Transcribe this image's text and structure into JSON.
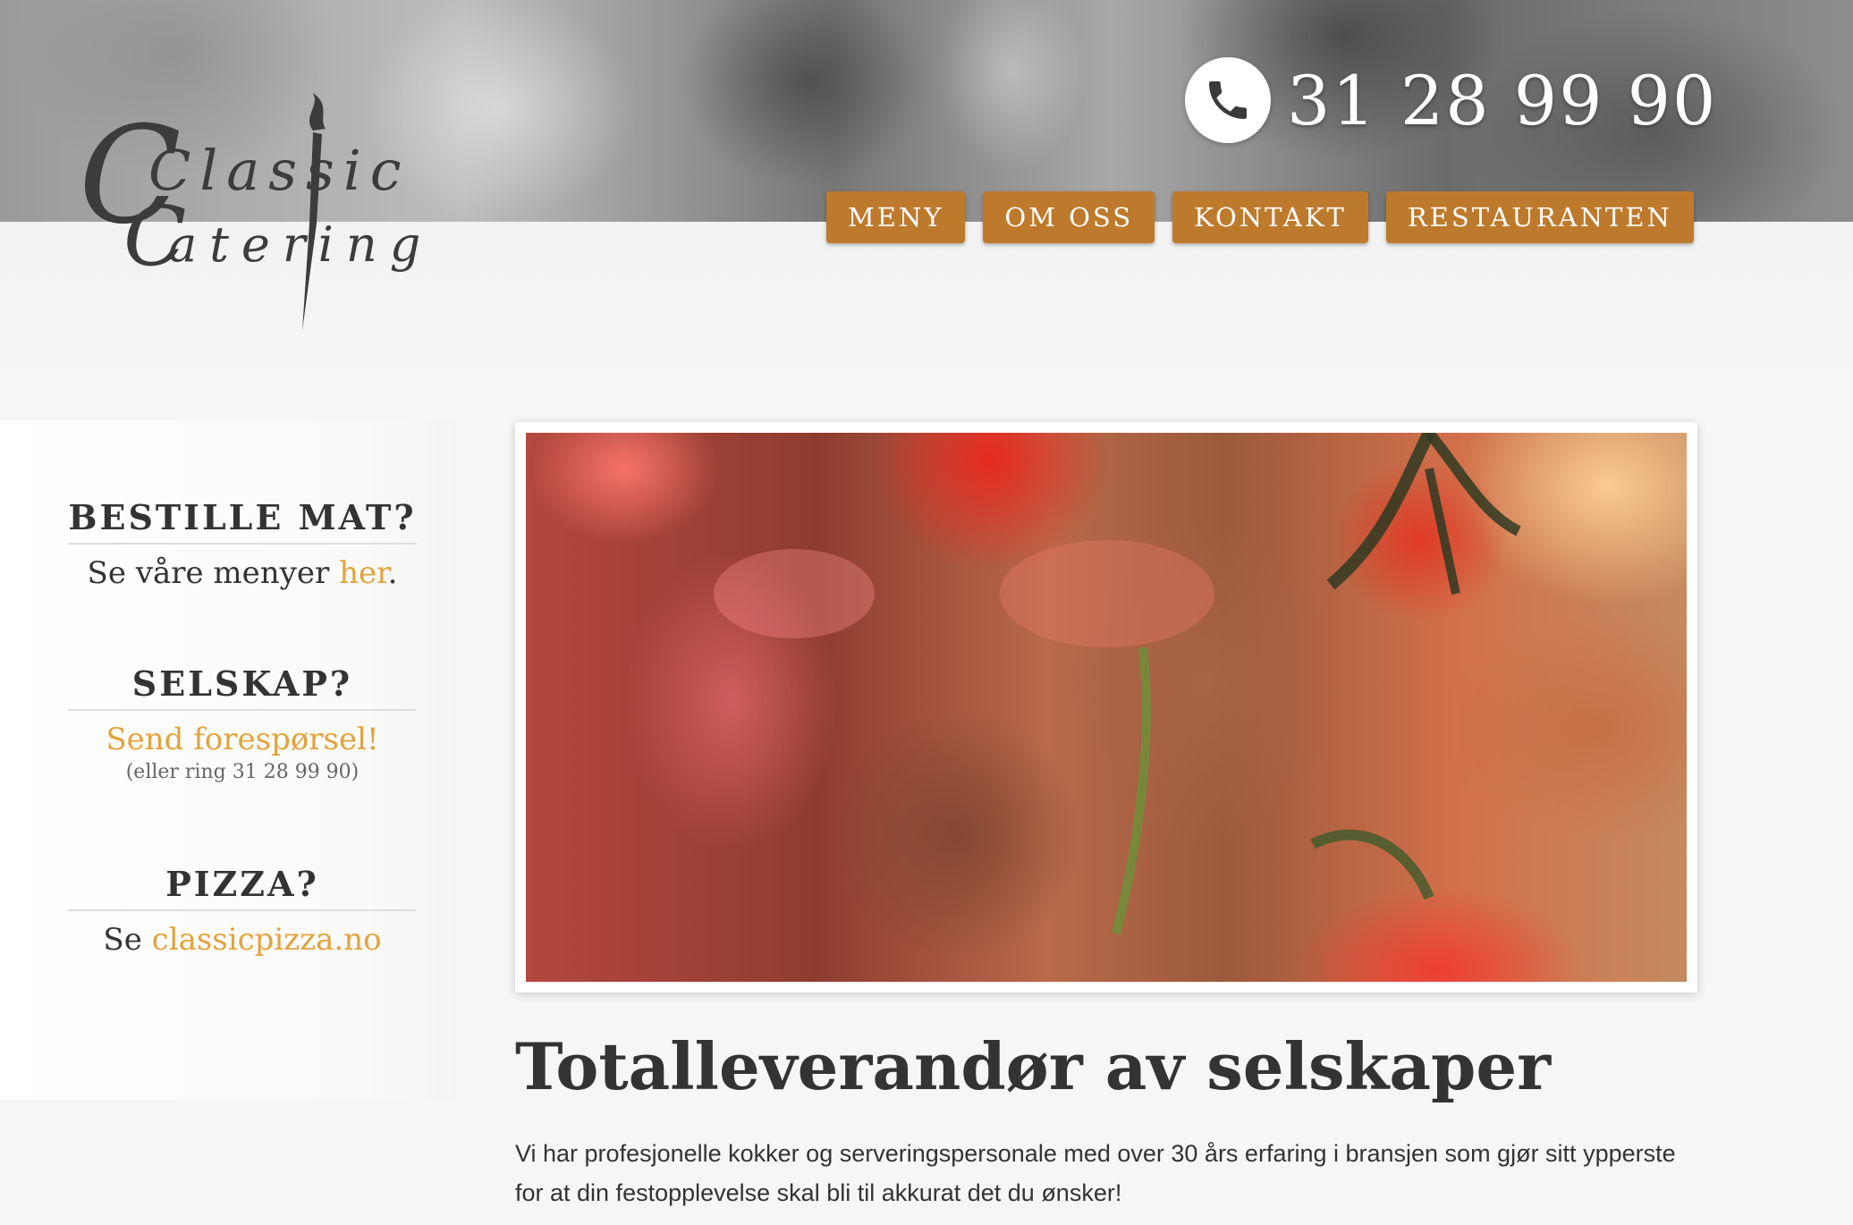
{
  "brand": {
    "logo_word1": "Classic",
    "logo_word2": "Catering"
  },
  "phone": {
    "number": "31 28 99 90",
    "icon": "phone-icon"
  },
  "nav": {
    "items": [
      {
        "label": "MENY"
      },
      {
        "label": "OM OSS"
      },
      {
        "label": "KONTAKT"
      },
      {
        "label": "RESTAURANTEN"
      }
    ]
  },
  "sidebar": {
    "order": {
      "title": "BESTILLE MAT?",
      "text_before": "Se våre menyer ",
      "link": "her",
      "text_after": "."
    },
    "party": {
      "title": "SELSKAP?",
      "link": "Send forespørsel!",
      "sub": "(eller ring 31 28 99 90)"
    },
    "pizza": {
      "title": "PIZZA?",
      "text_before": "Se ",
      "link": "classicpizza.no"
    }
  },
  "main": {
    "heading": "Totalleverandør av selskaper",
    "text": "Vi har profesjonelle kokker og serveringspersonale med over 30 års erfaring i bransjen som gjør sitt ypperste for at din festopplevelse skal bli til akkurat det du ønsker!"
  },
  "colors": {
    "accent": "#be7a2c",
    "link": "#e3a33b",
    "text": "#333333"
  }
}
